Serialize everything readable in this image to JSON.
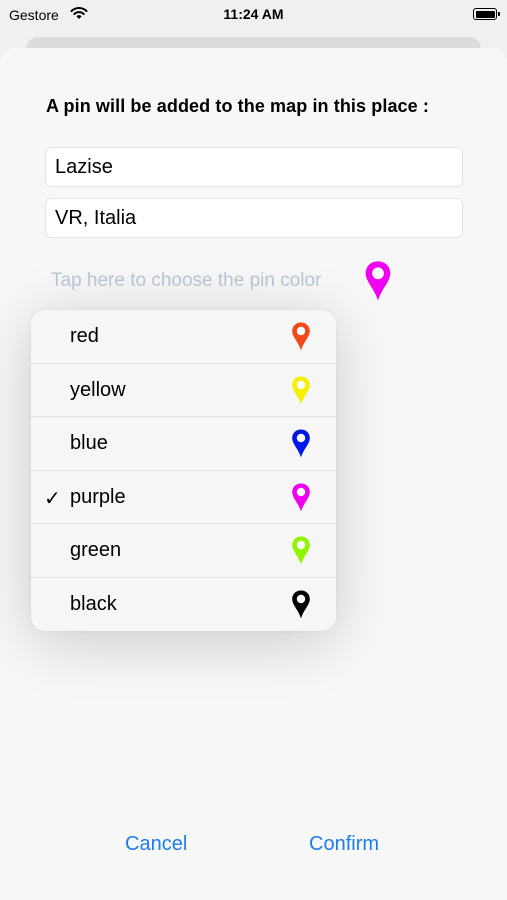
{
  "status_bar": {
    "carrier": "Gestore",
    "time": "11:24 AM",
    "icons": [
      "wifi-icon",
      "battery-icon"
    ]
  },
  "sheet": {
    "prompt": "A pin will be added to the map in this place :",
    "city_value": "Lazise",
    "region_value": "VR, Italia",
    "color_prompt": "Tap here to choose the pin color",
    "selected_pin_color": "#f000f0"
  },
  "color_menu": {
    "items": [
      {
        "label": "red",
        "color": "#f04a1c",
        "checked": false
      },
      {
        "label": "yellow",
        "color": "#f3f000",
        "checked": false
      },
      {
        "label": "blue",
        "color": "#0018e6",
        "checked": false
      },
      {
        "label": "purple",
        "color": "#f000f0",
        "checked": true
      },
      {
        "label": "green",
        "color": "#8ff500",
        "checked": false
      },
      {
        "label": "black",
        "color": "#000000",
        "checked": false
      }
    ],
    "check_glyph": "✓"
  },
  "footer": {
    "cancel_label": "Cancel",
    "confirm_label": "Confirm"
  }
}
